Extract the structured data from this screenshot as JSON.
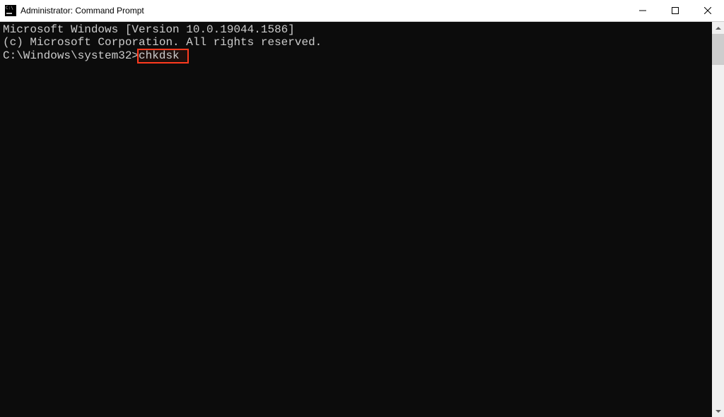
{
  "window": {
    "title": "Administrator: Command Prompt"
  },
  "terminal": {
    "line1": "Microsoft Windows [Version 10.0.19044.1586]",
    "line2": "(c) Microsoft Corporation. All rights reserved.",
    "blank": "",
    "prompt": "C:\\Windows\\system32>",
    "command": "chkdsk "
  },
  "highlight": {
    "color": "#ff3b1f"
  }
}
